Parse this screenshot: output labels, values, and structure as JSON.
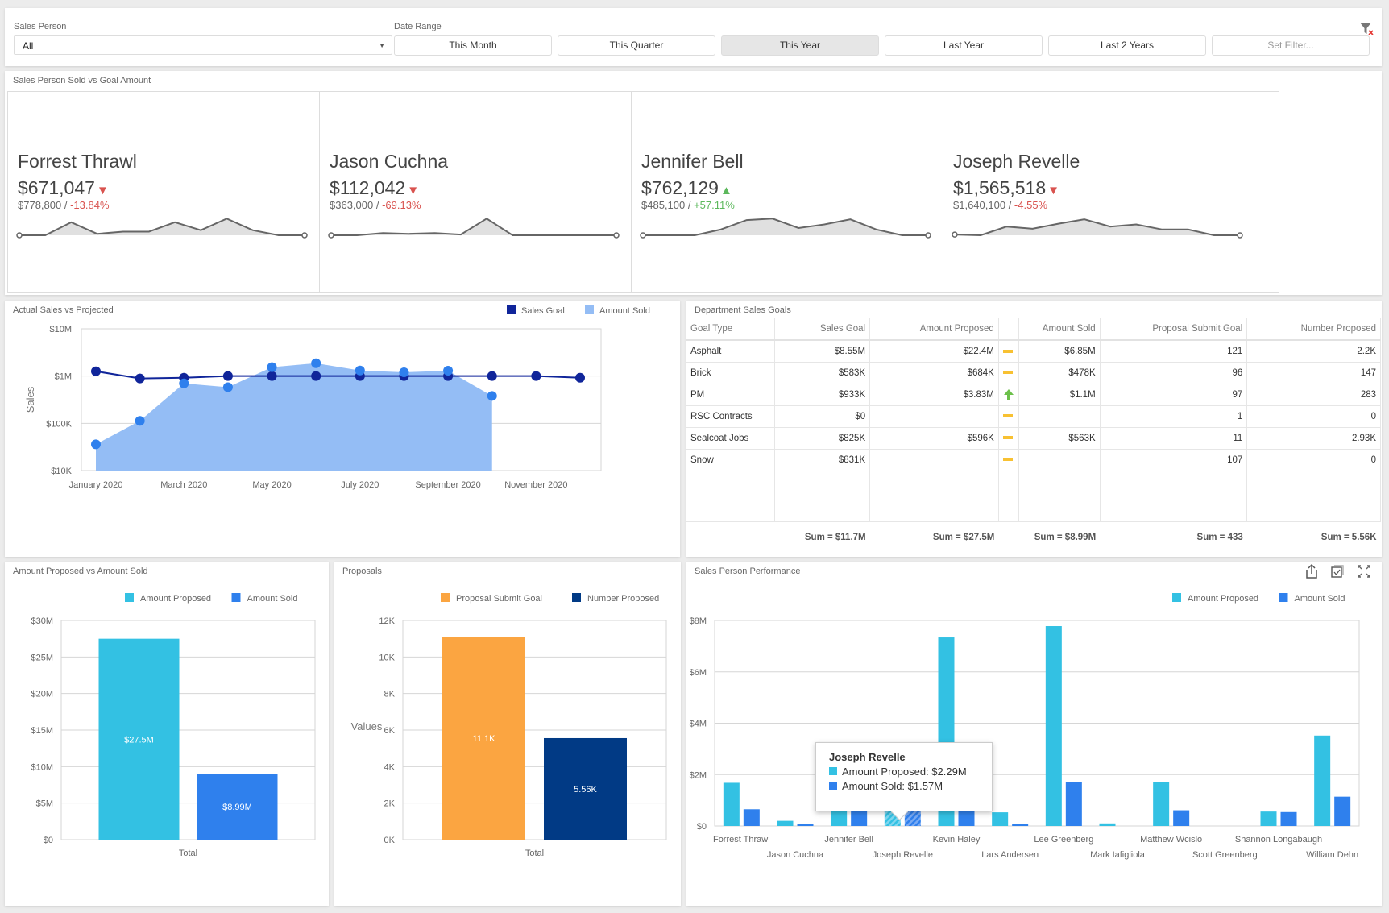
{
  "filters": {
    "sales_person_label": "Sales Person",
    "sales_person_value": "All",
    "date_range_label": "Date Range",
    "date_range_options": [
      "This Month",
      "This Quarter",
      "This Year",
      "Last Year",
      "Last 2 Years",
      "Set Filter..."
    ],
    "date_range_selected": "This Year"
  },
  "kpi_section": {
    "title": "Sales Person Sold vs Goal Amount",
    "cards": [
      {
        "name": "Forrest Thrawl",
        "value": "$671,047",
        "trend": "down",
        "goal": "$778,800",
        "delta": "-13.84%",
        "spark": [
          0,
          0,
          0.9,
          0.1,
          0.25,
          0.25,
          0.9,
          0.35,
          1.15,
          0.35,
          0,
          0
        ]
      },
      {
        "name": "Jason Cuchna",
        "value": "$112,042",
        "trend": "down",
        "goal": "$363,000",
        "delta": "-69.13%",
        "spark": [
          0,
          0,
          0.15,
          0.1,
          0.15,
          0.05,
          1.15,
          0,
          0,
          0,
          0,
          0
        ]
      },
      {
        "name": "Jennifer Bell",
        "value": "$762,129",
        "trend": "up",
        "goal": "$485,100",
        "delta": "+57.11%",
        "spark": [
          0,
          0,
          0,
          0.4,
          1.05,
          1.15,
          0.5,
          0.75,
          1.1,
          0.4,
          0,
          0
        ]
      },
      {
        "name": "Joseph Revelle",
        "value": "$1,565,518",
        "trend": "down",
        "goal": "$1,640,100",
        "delta": "-4.55%",
        "spark": [
          0.05,
          0,
          0.6,
          0.45,
          0.8,
          1.1,
          0.6,
          0.75,
          0.4,
          0.4,
          0,
          0
        ]
      }
    ]
  },
  "colors": {
    "sales_goal": "#10259a",
    "amount_sold_area": "#94bdf5",
    "amount_sold_point": "#2f80ed",
    "amount_proposed": "#33c1e3",
    "amount_sold": "#2f80ed",
    "proposal_goal": "#fba541",
    "number_proposed": "#013a85",
    "down": "#d9534f",
    "up": "#5cb85c",
    "neutral": "#f8c132"
  },
  "chart_data": [
    {
      "id": "actual-vs-projected",
      "type": "line",
      "title": "Actual Sales vs Projected",
      "xlabel": "",
      "ylabel": "Sales",
      "yscale": "log",
      "ylim": [
        10000,
        10000000
      ],
      "yticks": [
        "$10K",
        "$100K",
        "$1M",
        "$10M"
      ],
      "x": [
        "Jan 2020",
        "Feb 2020",
        "Mar 2020",
        "Apr 2020",
        "May 2020",
        "Jun 2020",
        "Jul 2020",
        "Aug 2020",
        "Sep 2020",
        "Oct 2020",
        "Nov 2020",
        "Dec 2020"
      ],
      "xtick_labels": [
        "January 2020",
        "March 2020",
        "May 2020",
        "July 2020",
        "September 2020",
        "November 2020"
      ],
      "legend": "top-right",
      "grid": true,
      "series": [
        {
          "name": "Sales Goal",
          "kind": "line",
          "values": [
            1260000,
            890000,
            920000,
            1000000,
            1000000,
            1000000,
            1000000,
            1000000,
            1000000,
            1000000,
            1000000,
            920000
          ]
        },
        {
          "name": "Amount Sold",
          "kind": "area",
          "values": [
            36000,
            113000,
            700000,
            580000,
            1540000,
            1870000,
            1310000,
            1200000,
            1300000,
            380000,
            null,
            null
          ]
        }
      ]
    },
    {
      "id": "proposed-vs-sold",
      "type": "bar",
      "title": "Amount Proposed vs Amount Sold",
      "categories": [
        "Total"
      ],
      "ylim": [
        0,
        30000000
      ],
      "yticks": [
        "$0",
        "$5M",
        "$10M",
        "$15M",
        "$20M",
        "$25M",
        "$30M"
      ],
      "legend": "top-right",
      "series": [
        {
          "name": "Amount Proposed",
          "values": [
            27500000
          ],
          "labels": [
            "$27.5M"
          ]
        },
        {
          "name": "Amount Sold",
          "values": [
            8990000
          ],
          "labels": [
            "$8.99M"
          ]
        }
      ]
    },
    {
      "id": "proposals",
      "type": "bar",
      "title": "Proposals",
      "ylabel": "Values",
      "categories": [
        "Total"
      ],
      "ylim": [
        0,
        12000
      ],
      "yticks": [
        "0K",
        "2K",
        "4K",
        "6K",
        "8K",
        "10K",
        "12K"
      ],
      "legend": "top-right",
      "series": [
        {
          "name": "Proposal Submit Goal",
          "values": [
            11100
          ],
          "labels": [
            "11.1K"
          ]
        },
        {
          "name": "Number Proposed",
          "values": [
            5560
          ],
          "labels": [
            "5.56K"
          ]
        }
      ]
    },
    {
      "id": "sales-person-performance",
      "type": "bar",
      "title": "Sales Person Performance",
      "categories": [
        "Forrest Thrawl",
        "Jason Cuchna",
        "Jennifer Bell",
        "Joseph Revelle",
        "Kevin Haley",
        "Lars Andersen",
        "Lee Greenberg",
        "Mark Iafigliola",
        "Matthew Wcislo",
        "Scott Greenberg",
        "Shannon Longabaugh",
        "William Dehn"
      ],
      "ylim": [
        0,
        8000000
      ],
      "yticks": [
        "$0",
        "$2M",
        "$4M",
        "$6M",
        "$8M"
      ],
      "legend": "top-right",
      "highlighted": "Joseph Revelle",
      "series": [
        {
          "name": "Amount Proposed",
          "values": [
            1680000,
            200000,
            1750000,
            2290000,
            7340000,
            530000,
            7780000,
            100000,
            1720000,
            0,
            560000,
            3520000
          ]
        },
        {
          "name": "Amount Sold",
          "values": [
            650000,
            90000,
            740000,
            1570000,
            1650000,
            80000,
            1700000,
            0,
            610000,
            0,
            540000,
            1140000
          ]
        }
      ]
    }
  ],
  "department_table": {
    "title": "Department Sales Goals",
    "columns": [
      "Goal Type",
      "Sales Goal",
      "Amount Proposed",
      "",
      "Amount Sold",
      "Proposal Submit Goal",
      "Number Proposed"
    ],
    "rows": [
      {
        "goal_type": "Asphalt",
        "sales_goal": "$8.55M",
        "amount_proposed": "$22.4M",
        "indicator": "neutral",
        "amount_sold": "$6.85M",
        "proposal_goal": "121",
        "number_proposed": "2.2K"
      },
      {
        "goal_type": "Brick",
        "sales_goal": "$583K",
        "amount_proposed": "$684K",
        "indicator": "neutral",
        "amount_sold": "$478K",
        "proposal_goal": "96",
        "number_proposed": "147"
      },
      {
        "goal_type": "PM",
        "sales_goal": "$933K",
        "amount_proposed": "$3.83M",
        "indicator": "up",
        "amount_sold": "$1.1M",
        "proposal_goal": "97",
        "number_proposed": "283"
      },
      {
        "goal_type": "RSC Contracts",
        "sales_goal": "$0",
        "amount_proposed": "",
        "indicator": "neutral",
        "amount_sold": "",
        "proposal_goal": "1",
        "number_proposed": "0"
      },
      {
        "goal_type": "Sealcoat Jobs",
        "sales_goal": "$825K",
        "amount_proposed": "$596K",
        "indicator": "neutral",
        "amount_sold": "$563K",
        "proposal_goal": "11",
        "number_proposed": "2.93K"
      },
      {
        "goal_type": "Snow",
        "sales_goal": "$831K",
        "amount_proposed": "",
        "indicator": "neutral",
        "amount_sold": "",
        "proposal_goal": "107",
        "number_proposed": "0"
      }
    ],
    "totals": {
      "sales_goal": "Sum = $11.7M",
      "amount_proposed": "Sum = $27.5M",
      "amount_sold": "Sum = $8.99M",
      "proposal_goal": "Sum = 433",
      "number_proposed": "Sum = 5.56K"
    }
  },
  "tooltip": {
    "title": "Joseph Revelle",
    "rows": [
      "Amount Proposed: $2.29M",
      "Amount Sold: $1.57M"
    ]
  },
  "performance_toolbar": {
    "icons": [
      "export-icon",
      "multi-select-icon",
      "fullscreen-icon"
    ]
  }
}
